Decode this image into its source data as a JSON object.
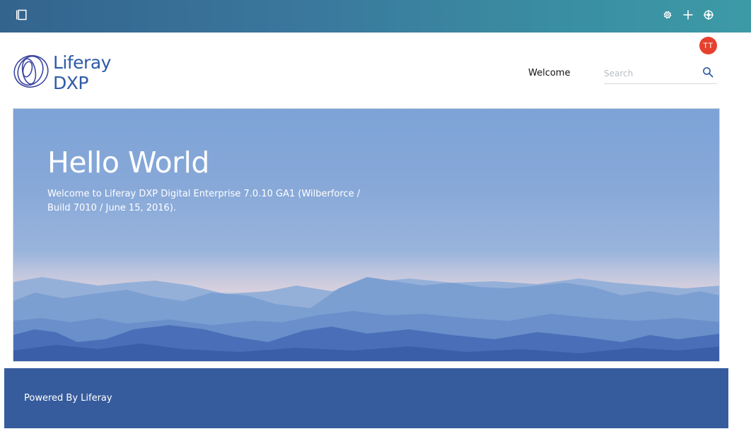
{
  "topbar": {
    "icons": [
      "sidebar-toggle-icon",
      "gear-icon",
      "plus-icon",
      "simulation-icon"
    ],
    "gradient_colors": [
      "#33648e",
      "#3c9aa6"
    ]
  },
  "user": {
    "avatar_initials": "TT",
    "avatar_color": "#e5412e"
  },
  "header": {
    "site_name": "Liferay DXP",
    "nav": {
      "welcome_label": "Welcome"
    },
    "search": {
      "placeholder": "Search",
      "value": ""
    }
  },
  "hero": {
    "title": "Hello World",
    "text": "Welcome to Liferay DXP Digital Enterprise 7.0.10 GA1 (Wilberforce / Build 7010 / June 15, 2016)."
  },
  "footer": {
    "text": "Powered By Liferay",
    "background": "#375c9d"
  },
  "colors": {
    "brand": "#2e5aa8"
  }
}
